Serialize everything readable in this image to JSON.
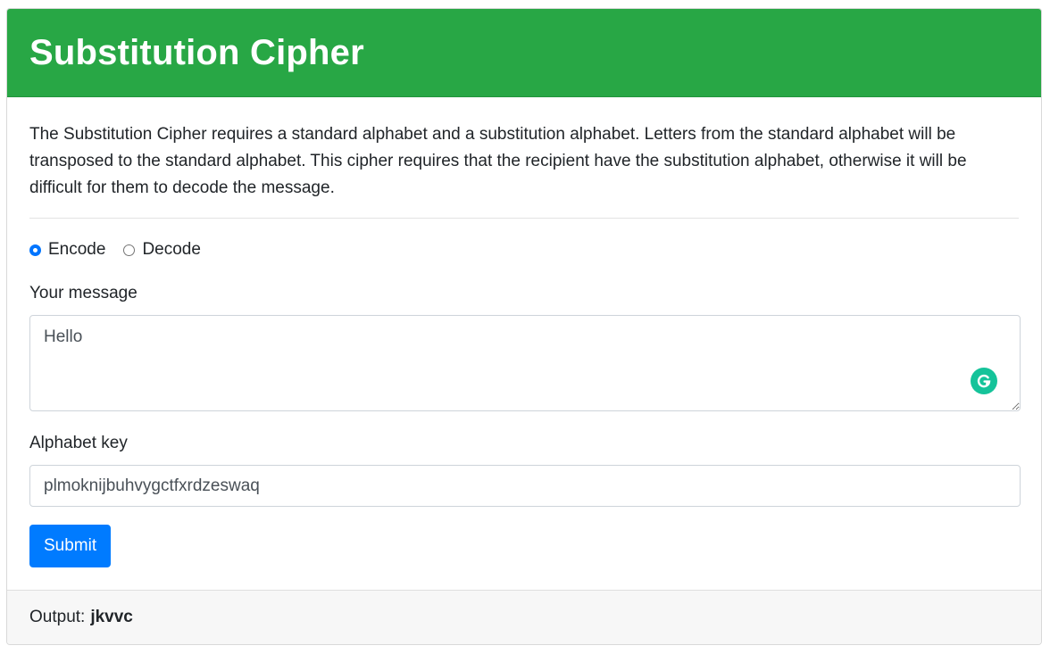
{
  "header": {
    "title": "Substitution Cipher"
  },
  "description": "The Substitution Cipher requires a standard alphabet and a substitution alphabet. Letters from the standard alphabet will be transposed to the standard alphabet. This cipher requires that the recipient have the substitution alphabet, otherwise it will be difficult for them to decode the message.",
  "mode": {
    "options": [
      {
        "label": "Encode",
        "checked": true
      },
      {
        "label": "Decode",
        "checked": false
      }
    ]
  },
  "message": {
    "label": "Your message",
    "value": "Hello"
  },
  "key": {
    "label": "Alphabet key",
    "value": "plmoknijbuhvygctfxrdzeswaq"
  },
  "submit": {
    "label": "Submit"
  },
  "output": {
    "label": "Output:",
    "value": "jkvvc"
  },
  "colors": {
    "header_bg": "#28a745",
    "button_bg": "#007bff",
    "grammarly": "#15c39a",
    "radio_checked": "#0075ff"
  },
  "icons": {
    "grammarly": "grammarly-icon"
  }
}
